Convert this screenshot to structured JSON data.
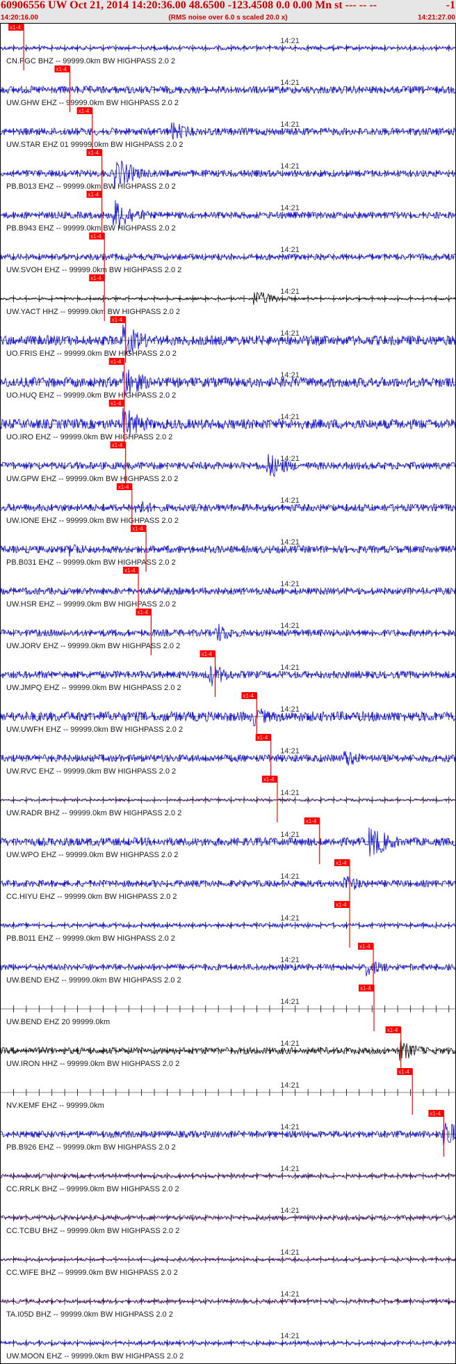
{
  "header": {
    "title": "60906556 UW Oct 21, 2014 14:20:36.00   48.6500 -123.4508  0.0 0.00 Mn st --- -- --",
    "title_right": "-1",
    "subtitle": "(RMS noise over 6.0 s scaled 20.0 x)",
    "start_time": "14:20:16.00",
    "end_time": "14:21:27.00"
  },
  "colors": {
    "header_bg": "#e6e6e6",
    "header_text": "#cc0000",
    "pick": "#ff0000",
    "blue_trace": "#0000dd",
    "black_trace": "#000000",
    "purple_trace": "#330066"
  },
  "chart_data": {
    "type": "line",
    "x_unit": "seconds after 14:20:16.00",
    "xlim": [
      0,
      71
    ],
    "minute_mark_label": "14:21",
    "minute_mark_x": 44,
    "pick_label": "x1-4",
    "tick_interval_s": 2,
    "series": [
      {
        "name": "CN.PGC BHZ -- 99999.0km BW  HIGHPASS  2.0  2",
        "pick": 3.6,
        "color": "#0000dd",
        "amplitude": 0.12,
        "event_peak": null,
        "event_x": null
      },
      {
        "name": "UW.GHW EHZ -- 99999.0km BW  HIGHPASS  2.0  2",
        "pick": 10.8,
        "color": "#0000dd",
        "amplitude": 0.22,
        "event_peak": 0.25,
        "event_x": 13
      },
      {
        "name": "UW.STAR EHZ 01 99999.0km BW  HIGHPASS  2.0  2",
        "pick": 14.3,
        "color": "#0000dd",
        "amplitude": 0.22,
        "event_peak": 0.6,
        "event_x": 27
      },
      {
        "name": "PB.B013 EHZ -- 99999.0km BW  HIGHPASS  2.0  2",
        "pick": 15.8,
        "color": "#0000dd",
        "amplitude": 0.2,
        "event_peak": 1,
        "event_x": 18
      },
      {
        "name": "PB.B943 EHZ -- 99999.0km BW  HIGHPASS  2.0  2",
        "pick": 15.8,
        "color": "#0000dd",
        "amplitude": 0.2,
        "event_peak": 1,
        "event_x": 18
      },
      {
        "name": "UW.SVOH EHZ -- 99999.0km BW  HIGHPASS  2.0  2",
        "pick": 16.2,
        "color": "#0000dd",
        "amplitude": 0.18,
        "event_peak": 0.25,
        "event_x": 20
      },
      {
        "name": "UW.YACT HHZ -- 99999.0km BW  HIGHPASS  2.0  2",
        "pick": 16.2,
        "color": "#000000",
        "amplitude": 0.08,
        "event_peak": 0.5,
        "event_x": 40
      },
      {
        "name": "UO.FRIS EHZ -- 99999.0km BW  HIGHPASS  2.0  2",
        "pick": 19.5,
        "color": "#0000dd",
        "amplitude": 0.3,
        "event_peak": 1,
        "event_x": 19.5
      },
      {
        "name": "UO.HUQ EHZ -- 99999.0km BW  HIGHPASS  2.0  2",
        "pick": 19.3,
        "color": "#0000dd",
        "amplitude": 0.3,
        "event_peak": 1,
        "event_x": 19.5
      },
      {
        "name": "UO.IRO EHZ -- 99999.0km BW  HIGHPASS  2.0  2",
        "pick": 19.3,
        "color": "#0000dd",
        "amplitude": 0.3,
        "event_peak": 1,
        "event_x": 19.5
      },
      {
        "name": "UW.GPW EHZ -- 99999.0km BW  HIGHPASS  2.0  2",
        "pick": 19.5,
        "color": "#0000dd",
        "amplitude": 0.22,
        "event_peak": 0.8,
        "event_x": 42
      },
      {
        "name": "UW.IONE EHZ -- 99999.0km BW  HIGHPASS  2.0  2",
        "pick": 20.5,
        "color": "#0000dd",
        "amplitude": 0.22,
        "event_peak": 0.5,
        "event_x": 21.5
      },
      {
        "name": "PB.B031 EHZ -- 99999.0km BW  HIGHPASS  2.0  2",
        "pick": 22.7,
        "color": "#0000dd",
        "amplitude": 0.22,
        "event_peak": 0.45,
        "event_x": 11
      },
      {
        "name": "UW.HSR EHZ -- 99999.0km BW  HIGHPASS  2.0  2",
        "pick": 21.5,
        "color": "#0000dd",
        "amplitude": 0.2,
        "event_peak": 0.25,
        "event_x": 26
      },
      {
        "name": "UW.JORV EHZ -- 99999.0km BW  HIGHPASS  2.0  2",
        "pick": 23.5,
        "color": "#0000dd",
        "amplitude": 0.2,
        "event_peak": 0.6,
        "event_x": 34
      },
      {
        "name": "UW.JMPQ EHZ -- 99999.0km BW  HIGHPASS  2.0  2",
        "pick": 33.5,
        "color": "#0000dd",
        "amplitude": 0.22,
        "event_peak": 0.7,
        "event_x": 33
      },
      {
        "name": "UW.UWFH EHZ -- 99999.0km BW  HIGHPASS  2.0  2",
        "pick": 40,
        "color": "#0000dd",
        "amplitude": 0.3,
        "event_peak": 0.6,
        "event_x": 40
      },
      {
        "name": "UW.RVC EHZ -- 99999.0km BW  HIGHPASS  2.0  2",
        "pick": 42.2,
        "color": "#0000dd",
        "amplitude": 0.22,
        "event_peak": 0.55,
        "event_x": 54
      },
      {
        "name": "UW.RADR BHZ -- 99999.0km BW  HIGHPASS  2.0  2",
        "pick": 43.2,
        "color": "#330066",
        "amplitude": 0.08,
        "event_peak": null,
        "event_x": null
      },
      {
        "name": "UW.WPO EHZ -- 99999.0km BW  HIGHPASS  2.0  2",
        "pick": 49.8,
        "color": "#0000dd",
        "amplitude": 0.25,
        "event_peak": 1,
        "event_x": 58
      },
      {
        "name": "CC.HIYU EHZ -- 99999.0km BW  HIGHPASS  2.0  2",
        "pick": 54.5,
        "color": "#0000dd",
        "amplitude": 0.2,
        "event_peak": 0.55,
        "event_x": 54
      },
      {
        "name": "PB.B011 EHZ -- 99999.0km BW  HIGHPASS  2.0  2",
        "pick": 54.5,
        "color": "#0000dd",
        "amplitude": 0.12,
        "event_peak": null,
        "event_x": null
      },
      {
        "name": "UW.BEND EHZ -- 99999.0km BW  HIGHPASS  2.0  2",
        "pick": 58.2,
        "color": "#0000dd",
        "amplitude": 0.18,
        "event_peak": 0.55,
        "event_x": 57.5
      },
      {
        "name": "UW.BEND EHZ 20 99999.0km",
        "pick": 58.3,
        "color": "#0000dd",
        "amplitude": 0,
        "event_peak": null,
        "event_x": null
      },
      {
        "name": "UW.IRON HHZ -- 99999.0km BW  HIGHPASS  2.0  2",
        "pick": 62.5,
        "color": "#000000",
        "amplitude": 0.2,
        "event_peak": 0.65,
        "event_x": 62.5
      },
      {
        "name": "NV.KEMF EHZ -- 99999.0km",
        "pick": 64.3,
        "color": "#0000dd",
        "amplitude": 0,
        "event_peak": null,
        "event_x": null
      },
      {
        "name": "PB.B926 EHZ -- 99999.0km BW  HIGHPASS  2.0  2",
        "pick": 69.2,
        "color": "#0000dd",
        "amplitude": 0.2,
        "event_peak": 1,
        "event_x": 69.5
      },
      {
        "name": "CC.RRLK BHZ -- 99999.0km BW  HIGHPASS  2.0  2",
        "pick": null,
        "color": "#330066",
        "amplitude": 0.12,
        "event_peak": null,
        "event_x": null
      },
      {
        "name": "CC.TCBU BHZ -- 99999.0km BW  HIGHPASS  2.0  2",
        "pick": null,
        "color": "#330066",
        "amplitude": 0.14,
        "event_peak": null,
        "event_x": null
      },
      {
        "name": "CC.WIFE BHZ -- 99999.0km BW  HIGHPASS  2.0  2",
        "pick": null,
        "color": "#330066",
        "amplitude": 0.1,
        "event_peak": null,
        "event_x": null
      },
      {
        "name": "TA.I05D BHZ -- 99999.0km BW  HIGHPASS  2.0  2",
        "pick": null,
        "color": "#330066",
        "amplitude": 0.12,
        "event_peak": null,
        "event_x": null
      },
      {
        "name": "UW.MOON EHZ -- 99999.0km BW  HIGHPASS  2.0  2",
        "pick": null,
        "color": "#0000dd",
        "amplitude": 0.12,
        "event_peak": null,
        "event_x": null
      }
    ]
  }
}
